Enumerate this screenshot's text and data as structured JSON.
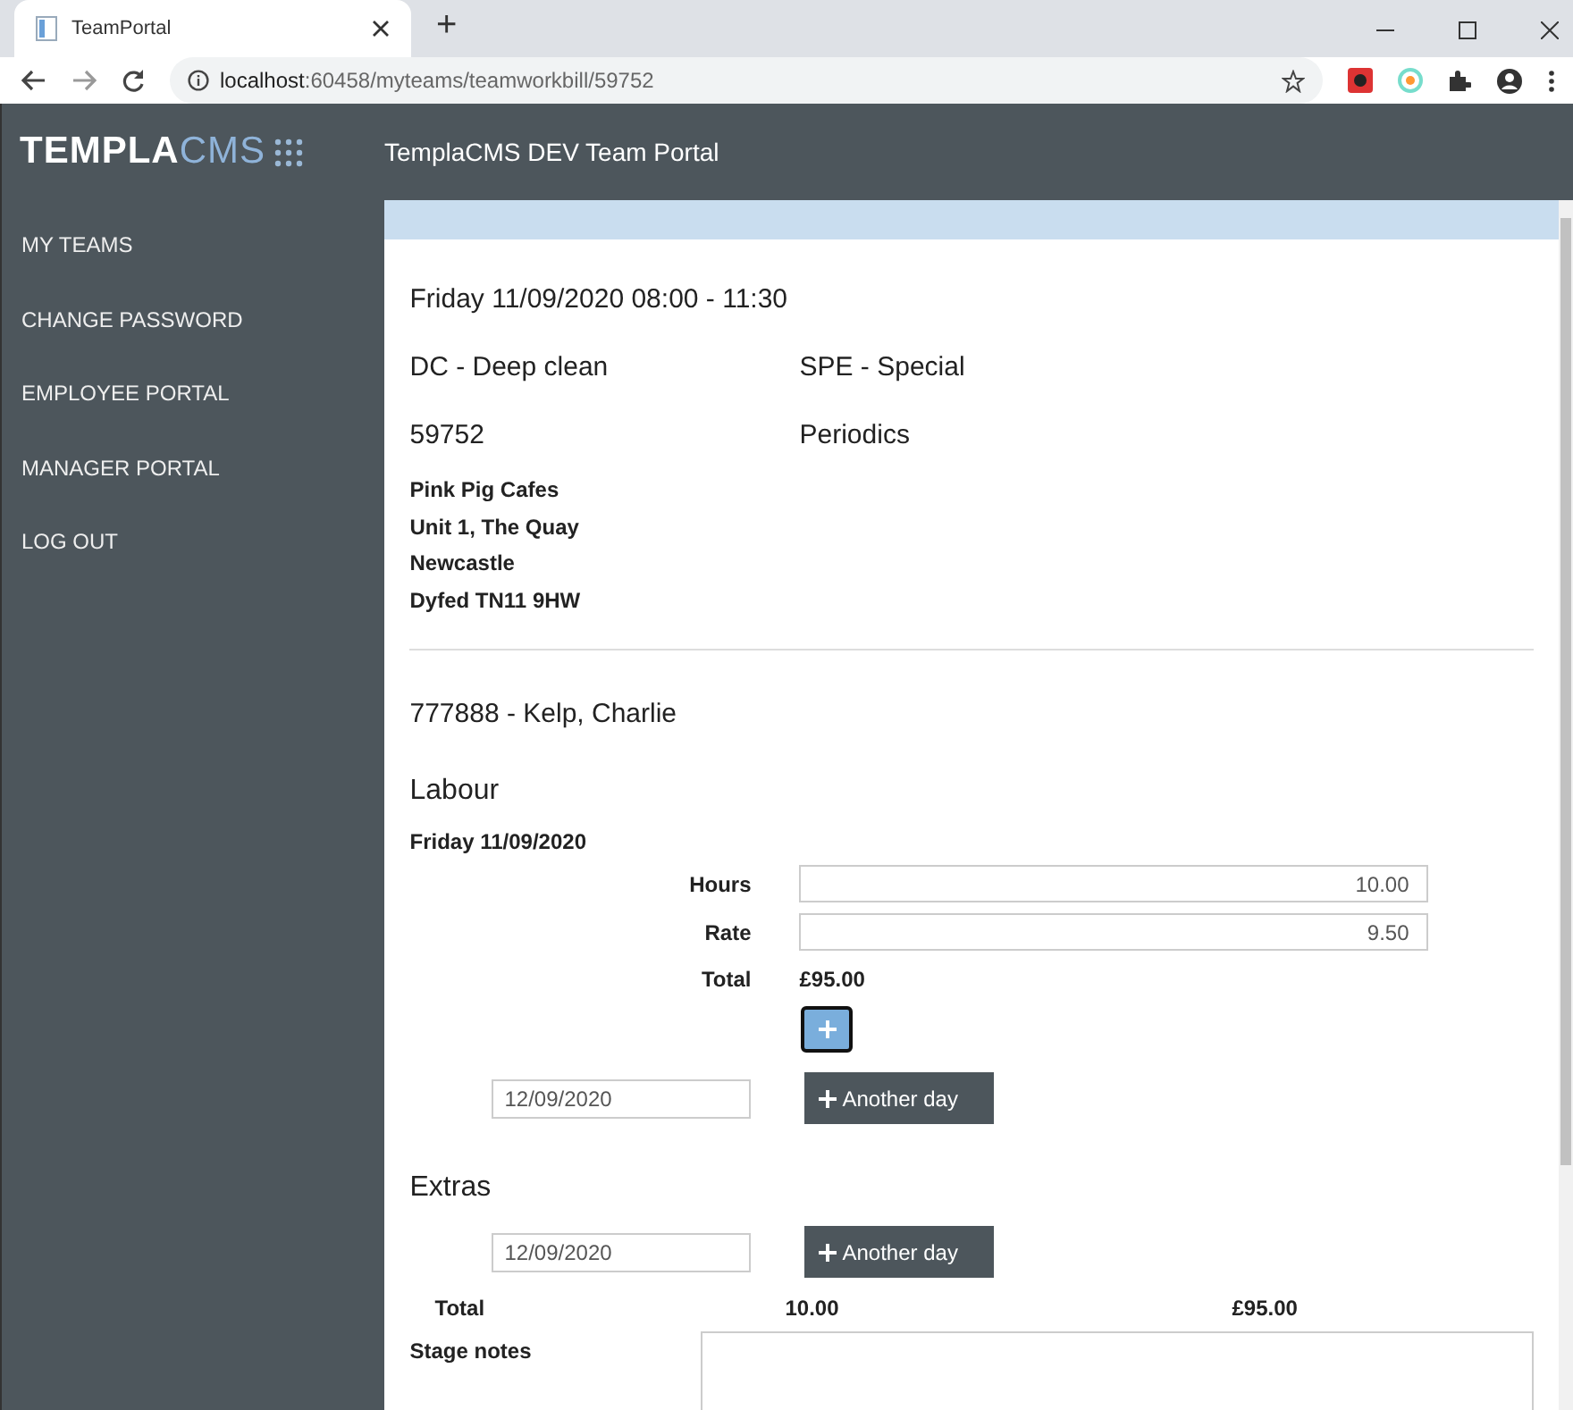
{
  "browser": {
    "tab_title": "TeamPortal",
    "new_tab": "+",
    "url_host": "localhost",
    "url_path": ":60458/myteams/teamworkbill/59752"
  },
  "logo": {
    "main": "TEMPLA",
    "accent": "CMS"
  },
  "header_title": "TemplaCMS DEV Team Portal",
  "sidebar": {
    "items": [
      {
        "label": "MY TEAMS"
      },
      {
        "label": "CHANGE PASSWORD"
      },
      {
        "label": "EMPLOYEE PORTAL"
      },
      {
        "label": "MANAGER PORTAL"
      },
      {
        "label": "LOG OUT"
      }
    ]
  },
  "job": {
    "title": "Friday 11/09/2020 08:00 - 11:30",
    "service": "DC - Deep clean",
    "category": "SPE - Special",
    "number": "59752",
    "type": "Periodics",
    "address": [
      "Pink Pig Cafes",
      "Unit 1, The Quay",
      "Newcastle",
      "Dyfed TN11 9HW"
    ]
  },
  "employee": "777888 - Kelp, Charlie",
  "labour": {
    "heading": "Labour",
    "day": "Friday 11/09/2020",
    "fields": [
      {
        "label": "Hours",
        "value": "10.00"
      },
      {
        "label": "Rate",
        "value": "9.50"
      }
    ],
    "total_label": "Total",
    "total": "£95.00",
    "new_date": "12/09/2020",
    "another_day": "Another day"
  },
  "extras": {
    "heading": "Extras",
    "new_date": "12/09/2020",
    "another_day": "Another day"
  },
  "totals": {
    "label": "Total",
    "hours": "10.00",
    "amount": "£95.00"
  },
  "stage_notes": {
    "label": "Stage notes"
  }
}
